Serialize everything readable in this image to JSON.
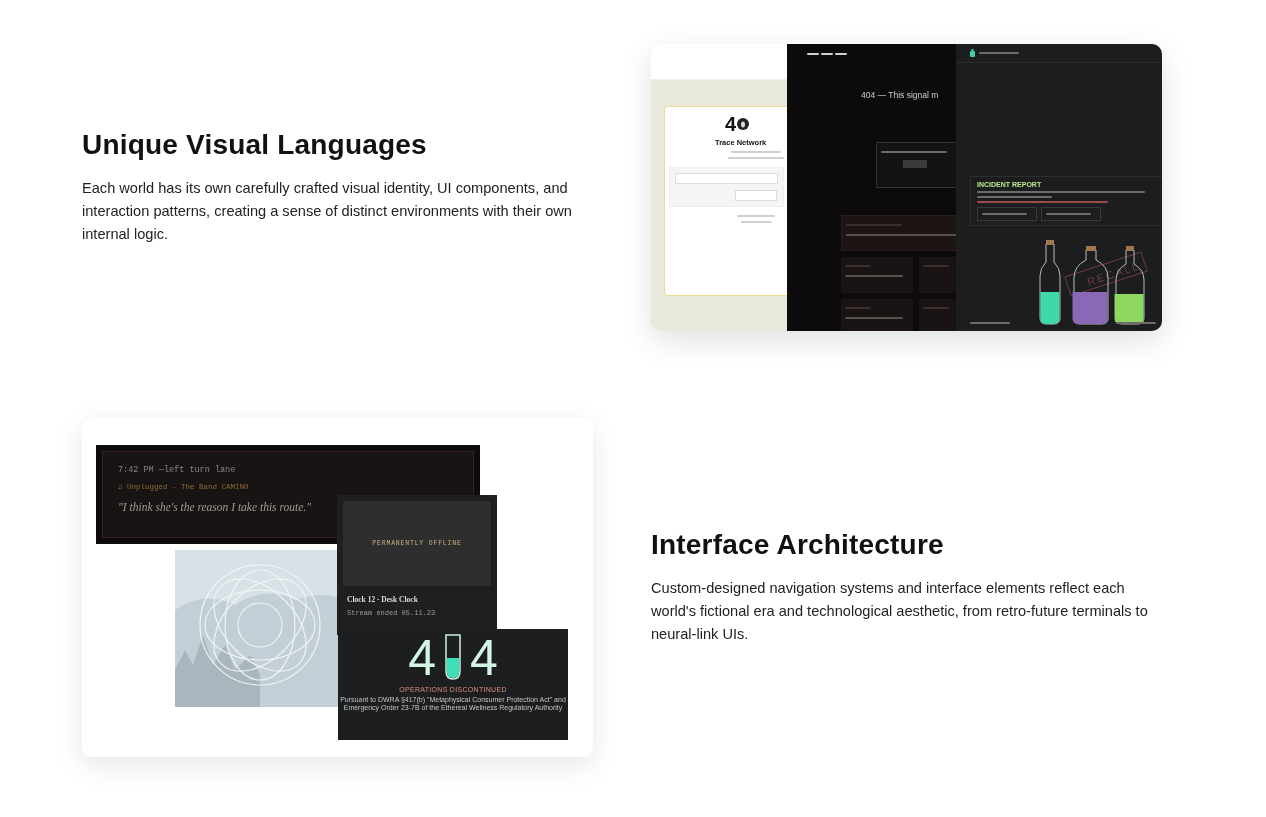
{
  "sections": [
    {
      "heading": "Unique Visual Languages",
      "body": "Each world has its own carefully crafted visual identity, UI components, and interaction patterns, creating a sense of distinct environments with their own internal logic.",
      "media": {
        "kind": "screens",
        "trace": {
          "digit": "4",
          "title": "Trace Network"
        },
        "signal": {
          "heading": "404 — This signal m"
        },
        "recall": {
          "report_title": "INCIDENT REPORT",
          "stamp": "RECALL"
        }
      }
    },
    {
      "heading": "Interface Architecture",
      "body": "Custom-designed navigation systems and interface elements reflect each world's fictional era and technological aesthetic, from retro-future terminals to neural-link UIs.",
      "media": {
        "kind": "collage",
        "drive": {
          "time": "7:42 PM —left turn lane",
          "song": "♫ Unplugged - The Band CAMINO",
          "quote": "\"I think she's the reason I take this route.\""
        },
        "clock": {
          "overlay": "PERMANENTLY OFFLINE",
          "title": "Clock 12 - Desk Clock",
          "status": "Stream ended 05.11.23"
        },
        "outage": {
          "left_digit": "4",
          "right_digit": "4",
          "title": "OPERATIONS DISCONTINUED",
          "notice": "Pursuant to DWRA §417(b) \"Metaphysical Consumer Protection Act\" and Emergency Order 23-7B of the Ethereal Wellness Regulatory Authority"
        }
      }
    }
  ]
}
